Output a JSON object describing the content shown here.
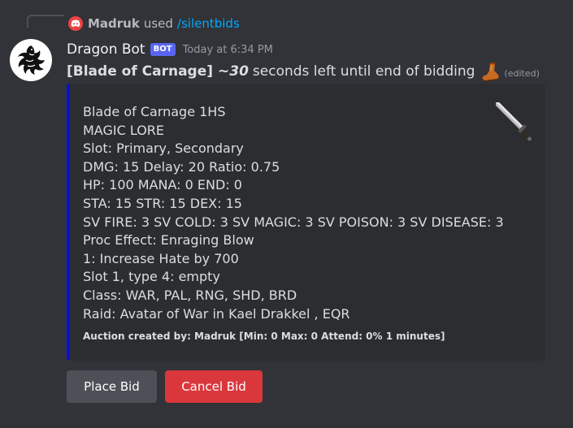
{
  "reply": {
    "username": "Madruk",
    "action": "used",
    "command": "/silentbids"
  },
  "bot": {
    "name": "Dragon Bot",
    "tag": "BOT",
    "timestamp": "Today at 6:34 PM"
  },
  "message": {
    "item_name": "[Blade of Carnage]",
    "seconds": "~30",
    "text": "seconds left until end of bidding",
    "edited": "(edited)"
  },
  "embed": {
    "color": "#0b0cde",
    "lines": [
      "Blade of Carnage 1HS",
      "MAGIC LORE",
      "Slot: Primary, Secondary",
      "DMG: 15 Delay: 20 Ratio: 0.75",
      "HP: 100 MANA: 0 END: 0",
      "STA: 15 STR: 15 DEX: 15",
      "SV FIRE: 3 SV COLD: 3 SV MAGIC: 3 SV POISON: 3 SV DISEASE: 3",
      "Proc Effect: Enraging Blow",
      "1: Increase Hate by 700",
      "Slot 1, type 4: empty",
      "Class: WAR, PAL, RNG, SHD, BRD",
      "Raid: Avatar of War in Kael Drakkel , EQR"
    ],
    "footer": "Auction created by: Madruk  [Min: 0  Max: 0  Attend: 0%  1 minutes]",
    "thumbnail_icon": "sword-icon"
  },
  "buttons": {
    "place_bid": "Place Bid",
    "cancel_bid": "Cancel Bid"
  },
  "colors": {
    "background": "#313338",
    "embed_background": "#2b2d31",
    "bot_tag": "#5865f2",
    "command_link": "#00a8fc",
    "cancel_button": "#da373c",
    "secondary_button": "#4e5058"
  }
}
